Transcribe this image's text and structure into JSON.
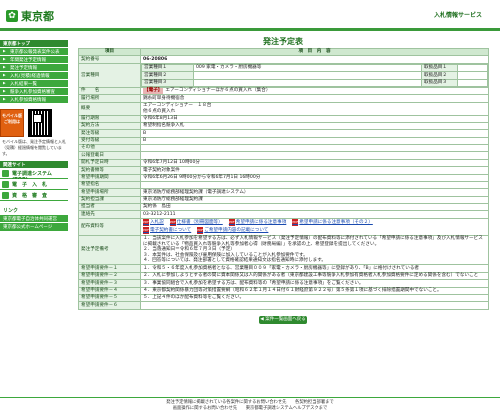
{
  "header": {
    "logo_text": "東京都",
    "system_title": "入札情報サービス"
  },
  "sidebar": {
    "head": "東京都トップ",
    "items": [
      "東京都公報発表案件公表",
      "年間発注予定情報",
      "発注予定情報",
      "入札(見積)経過情報",
      "入札結果一覧",
      "競争入札参加資格審査",
      "入札参加資格情報"
    ],
    "mobile_badge": "モバイル版 ご利用は",
    "mobile_note": "モバイル版は、発注予定情報と入札（見積）経過情報を閲覧しています。",
    "head2": "関連サイト",
    "links2": [
      "電子調達システム(TOP)",
      "電　子　入　札",
      "資　格　審　査"
    ],
    "head3": "リンク",
    "links3": [
      "東京都電子自治体共同運営",
      "東京都公式ホームページ"
    ]
  },
  "main": {
    "title": "発注予定表",
    "table_header": {
      "item": "項目",
      "content": "項　目　内　容"
    },
    "rows": [
      {
        "label": "契約番号",
        "value": "06-20806"
      },
      {
        "label": "営業種目",
        "sub": [
          {
            "k": "営業種目１",
            "v": "009 家電・カメラ・厨房機器等",
            "rk": "取扱品目１",
            "rv": ""
          },
          {
            "k": "営業種目２",
            "v": "",
            "rk": "取扱品目２",
            "rv": ""
          },
          {
            "k": "営業種目３",
            "v": "",
            "rk": "取扱品目３",
            "rv": ""
          }
        ]
      },
      {
        "label": "件　　名",
        "chip": "【電子】",
        "value": "エアーコンディショナーほか６点の買入れ（集合）"
      },
      {
        "label": "履行場所",
        "value": "錦糸町単身待機宿舎"
      },
      {
        "label": "概要",
        "value": "エアーコンディショナー　１８台\n他６点の買入れ"
      },
      {
        "label": "履行期限",
        "value": "令和6年8月13日"
      },
      {
        "label": "契約方法",
        "value": "希望制指名競争入札"
      },
      {
        "label": "発注等級",
        "value": "B"
      },
      {
        "label": "受付等級",
        "value": "B"
      },
      {
        "label": "その他",
        "value": ""
      },
      {
        "label": "公報登載日",
        "value": ""
      },
      {
        "label": "開札予定日時",
        "value": "令和6年7月12日 10時00分"
      },
      {
        "label": "契約書類等",
        "value": "電子契約対象案件"
      },
      {
        "label": "希望申請期間",
        "value": "令和6年6月26日 9時00分から令和6年7月1日 16時00分"
      },
      {
        "label": "希望指名",
        "value": ""
      },
      {
        "label": "希望申請場所",
        "value": "東京消防庁総務部経理契約課（電子調達システム）"
      },
      {
        "label": "契約担当課",
        "value": "東京消防庁総務部経理契約課"
      },
      {
        "label": "担当者",
        "value": "契約係　島田"
      },
      {
        "label": "連絡先",
        "value": "03-3212-2111"
      }
    ],
    "doc_label": "配布資料等",
    "files": [
      "入札説",
      "仕様書（別冊図面等）",
      "希望申請に係る注意事項",
      "希望申請に係る注意事項（その２）",
      "電子契約書について",
      "ご希望申請内容の記載について"
    ],
    "remarks_label": "発注予定備考",
    "remarks": "１．当該案件に入札参加を希望する方は、必ず入札情報サービス（発注予定情報）の配布資料等に添付されている「希望申請に係る注意事項」及び入札情報サービスに掲載されている「物品買入れ等競争入札等参加者心得（財務局編）」を承認の上、希望登録を提出してください。\n２．当落通知日＝令和６年７月３日（予定）\n３．本案件は、社会保険及び雇用保険に加入していることが入札参加要件です。\n４．回答等については、発注部署として資格確認結果通知文は指名通知時に添付します。",
    "cond_label": "希望申請要件",
    "conds": [
      "１．令和５・６年度入札参加資格者となる、営業種目００９「家電・カメラ・厨房機器等」に登録があり、「B」に格付けされている者",
      "２．入札に参加しようとする者の間に資本関係又は人的関係がある者（東京都建設工事等競争入札参加有資格者入札参加資格要件に定める関係を含む）でないこと",
      "３．事業協同組合で入札参加を希望する方は、配布資料等の「希望申請に係る注意事項」をご覧ください。",
      "４．東京都契約関係暴力団等対策措置要綱（昭和６２年１月１４日付６１財経庶第９２２号）第５条第１項に基づく排除措置期間中でないこと。",
      "５．上記４件のほか配布資料等をご覧ください。",
      ""
    ],
    "back_button": "案件一覧画面へ戻る"
  },
  "footer": {
    "line1": "発注予定情報に掲載されている各案件に関するお問い合わせ先　　各契約担当部署まで",
    "line2": "画面操作に関するお問い合わせ先　　東京都電子調達システムヘルプデスクまで"
  },
  "colors": {
    "brand_green": "#3da83d",
    "header_green": "#2f8a2f",
    "label_bg": "#e4f2e4",
    "chip_red": "#e8b4b4"
  }
}
